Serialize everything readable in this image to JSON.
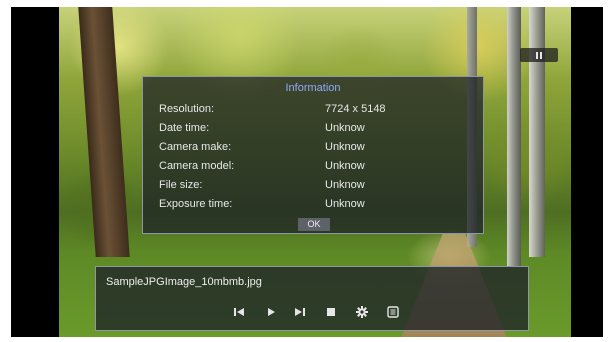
{
  "info_dialog": {
    "title": "Information",
    "rows": [
      {
        "label": "Resolution:",
        "value": "7724 x 5148"
      },
      {
        "label": "Date time:",
        "value": "Unknow"
      },
      {
        "label": "Camera make:",
        "value": "Unknow"
      },
      {
        "label": "Camera model:",
        "value": "Unknow"
      },
      {
        "label": "File size:",
        "value": "Unknow"
      },
      {
        "label": "Exposure time:",
        "value": "Unknow"
      }
    ],
    "ok_label": "OK"
  },
  "player": {
    "file_name": "SampleJPGImage_10mbmb.jpg",
    "status_icon": "pause-icon",
    "controls": [
      {
        "name": "previous-icon"
      },
      {
        "name": "play-icon"
      },
      {
        "name": "next-icon"
      },
      {
        "name": "stop-icon"
      },
      {
        "name": "settings-gear-icon"
      },
      {
        "name": "info-list-icon"
      }
    ]
  },
  "colors": {
    "dialog_title": "#8fa8ff",
    "text": "#e8e8e8",
    "panel_border": "#8d97a8"
  }
}
